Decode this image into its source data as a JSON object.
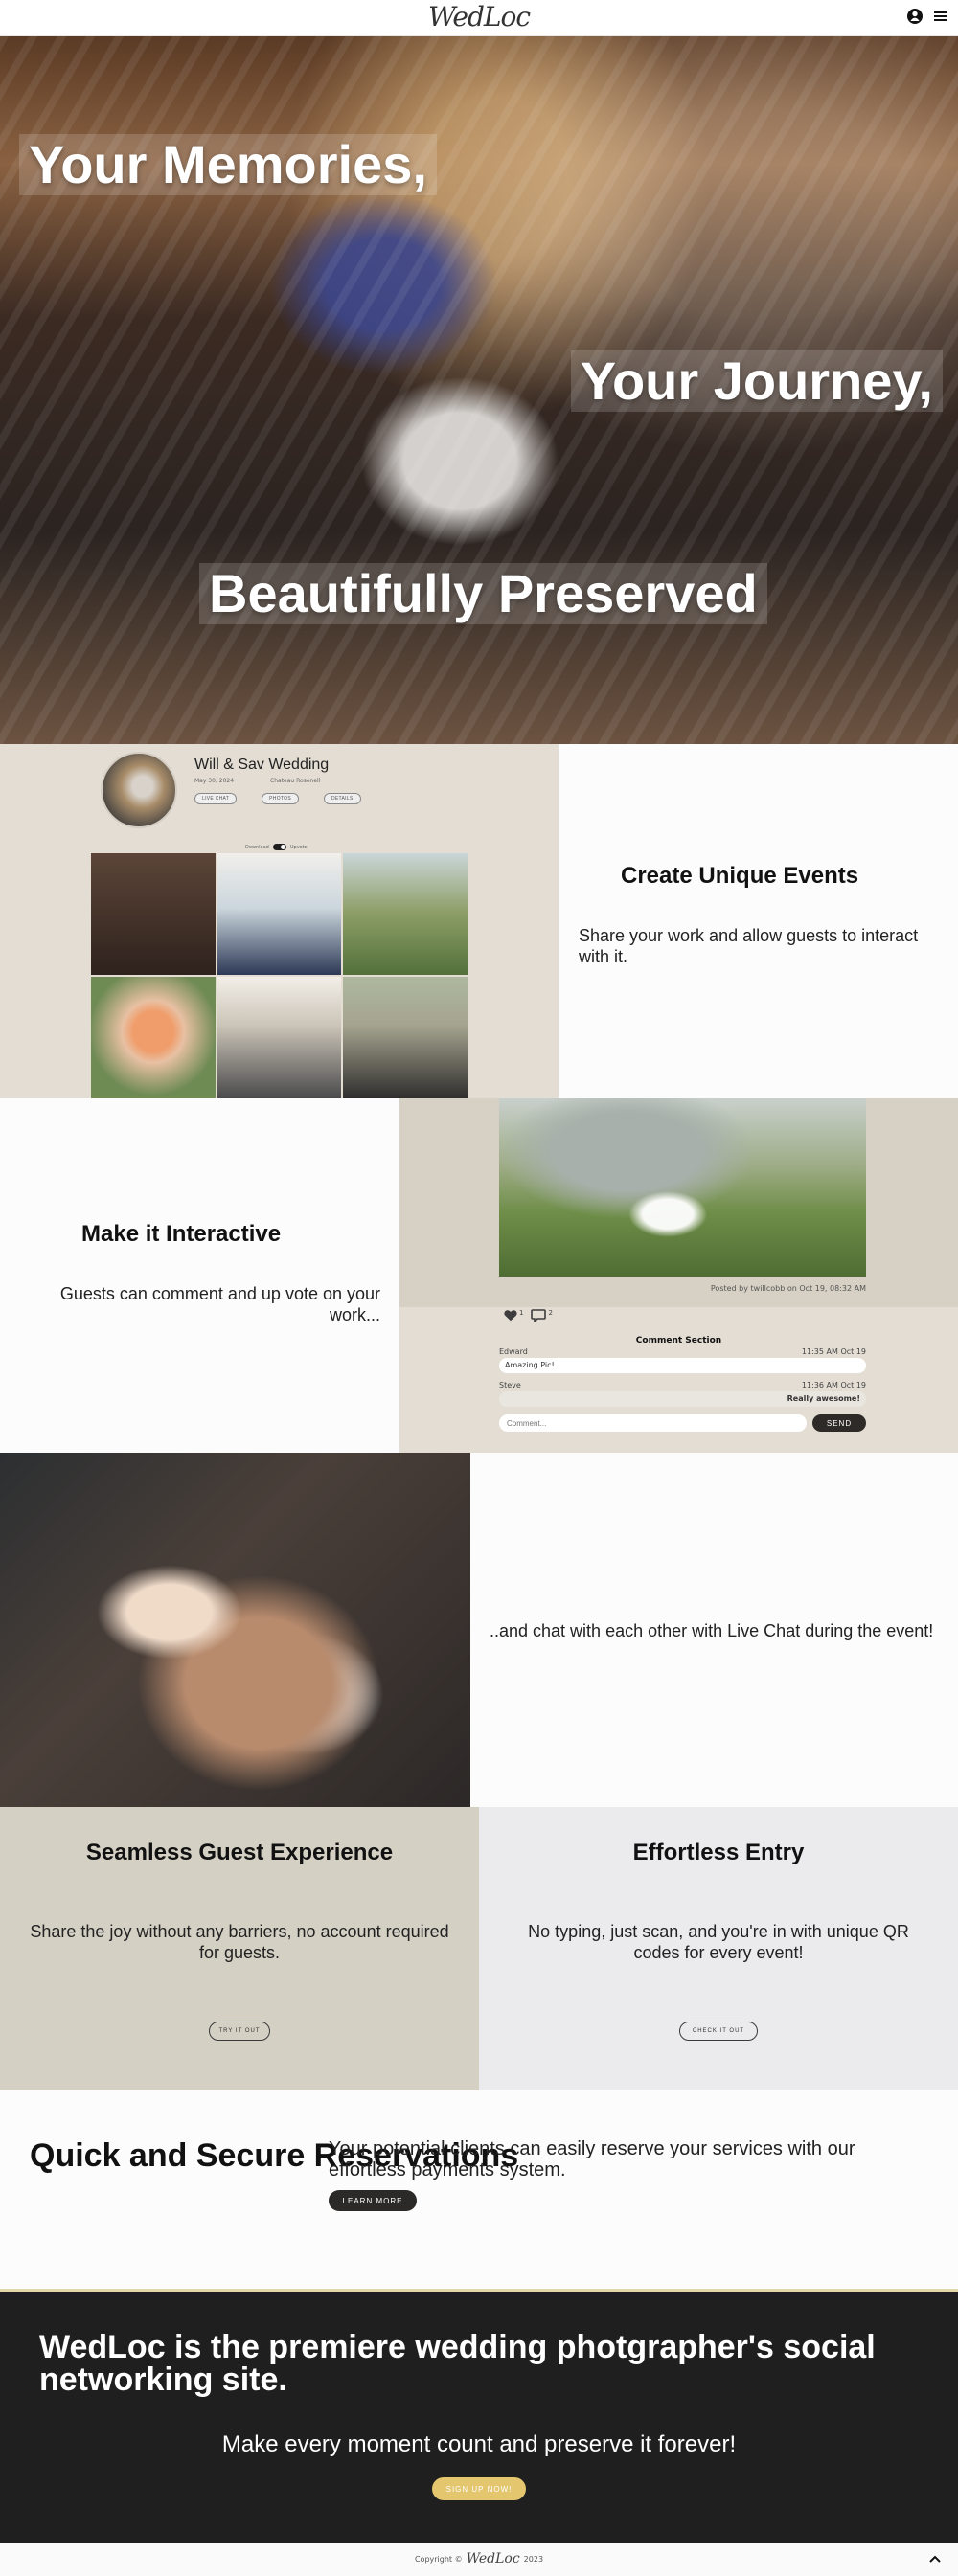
{
  "header": {
    "logo": "WedLoc",
    "icons": [
      "user-circle-icon",
      "menu-icon"
    ]
  },
  "hero": {
    "line1": "Your Memories,",
    "line2": "Your Journey,",
    "line3": "Beautifully Preserved"
  },
  "events": {
    "profile_name": "Will & Sav Wedding",
    "profile_meta": [
      "May 30, 2024",
      "Chateau Rosenell"
    ],
    "chips": [
      "LIVE CHAT",
      "PHOTOS",
      "DETAILS"
    ],
    "toggle_labels": [
      "Download",
      "Upvote"
    ],
    "title": "Create Unique Events",
    "description": "Share your work and allow guests to interact with it."
  },
  "interactive": {
    "title": "Make it Interactive",
    "description": "Guests can comment and up vote on your work...",
    "posted_by": "Posted by twillcobb on Oct 19, 08:32 AM",
    "likes": "1",
    "comments_count": "2",
    "comment_section_title": "Comment Section",
    "comments": [
      {
        "author": "Edward",
        "time": "11:35 AM Oct 19",
        "text": "Amazing Pic!"
      },
      {
        "author": "Steve",
        "time": "11:36 AM Oct 19",
        "text": "Really awesome!"
      }
    ],
    "comment_placeholder": "Comment...",
    "send_label": "SEND"
  },
  "chat": {
    "text_before": "..and chat with each other with ",
    "link_text": "Live Chat",
    "text_after": " during the event!"
  },
  "guest_experience": {
    "title": "Seamless Guest Experience",
    "description": "Share the joy without any barriers, no account required for guests.",
    "button": "TRY IT OUT"
  },
  "entry": {
    "title": "Effortless Entry",
    "description": "No typing, just scan, and you're in with unique QR codes for every event!",
    "button": "CHECK IT OUT"
  },
  "reservations": {
    "title": "Quick and Secure Reservations",
    "description": "Your potential clients can easily reserve your services with our effortless payments system.",
    "button": "LEARN MORE"
  },
  "cta": {
    "title": "WedLoc is the premiere wedding photgrapher's social networking site.",
    "subtitle": "Make every moment count and preserve it forever!",
    "button": "SIGN UP NOW!"
  },
  "footer": {
    "copyright_prefix": "Copyright ©",
    "logo": "WedLoc",
    "year": "2023",
    "back_to_top_icon": "chevron-up-icon"
  },
  "colors": {
    "beige": "#e3ddd3",
    "stone": "#d4d0c4",
    "light_gray": "#ebebed",
    "dark": "#1f1f1f",
    "gold": "#e3c66d"
  }
}
